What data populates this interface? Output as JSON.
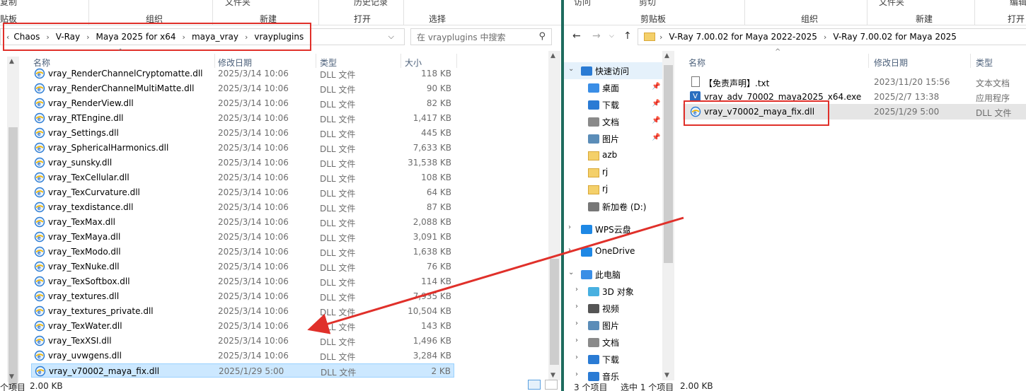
{
  "left": {
    "ribbon": {
      "top_items": [
        "复制",
        "文件夹",
        "历史记录"
      ],
      "groups": [
        "贴板",
        "组织",
        "新建",
        "打开",
        "选择"
      ]
    },
    "breadcrumb": [
      "Chaos",
      "V-Ray",
      "Maya 2025 for x64",
      "maya_vray",
      "vrayplugins"
    ],
    "search_placeholder": "在 vrayplugins 中搜索",
    "columns": {
      "name": "名称",
      "date": "修改日期",
      "type": "类型",
      "size": "大小"
    },
    "rows": [
      {
        "name": "vray_RenderChannelCryptomatte.dll",
        "date": "2025/3/14 10:06",
        "type": "DLL 文件",
        "size": "118 KB"
      },
      {
        "name": "vray_RenderChannelMultiMatte.dll",
        "date": "2025/3/14 10:06",
        "type": "DLL 文件",
        "size": "90 KB"
      },
      {
        "name": "vray_RenderView.dll",
        "date": "2025/3/14 10:06",
        "type": "DLL 文件",
        "size": "82 KB"
      },
      {
        "name": "vray_RTEngine.dll",
        "date": "2025/3/14 10:06",
        "type": "DLL 文件",
        "size": "1,417 KB"
      },
      {
        "name": "vray_Settings.dll",
        "date": "2025/3/14 10:06",
        "type": "DLL 文件",
        "size": "445 KB"
      },
      {
        "name": "vray_SphericalHarmonics.dll",
        "date": "2025/3/14 10:06",
        "type": "DLL 文件",
        "size": "7,633 KB"
      },
      {
        "name": "vray_sunsky.dll",
        "date": "2025/3/14 10:06",
        "type": "DLL 文件",
        "size": "31,538 KB"
      },
      {
        "name": "vray_TexCellular.dll",
        "date": "2025/3/14 10:06",
        "type": "DLL 文件",
        "size": "108 KB"
      },
      {
        "name": "vray_TexCurvature.dll",
        "date": "2025/3/14 10:06",
        "type": "DLL 文件",
        "size": "64 KB"
      },
      {
        "name": "vray_texdistance.dll",
        "date": "2025/3/14 10:06",
        "type": "DLL 文件",
        "size": "87 KB"
      },
      {
        "name": "vray_TexMax.dll",
        "date": "2025/3/14 10:06",
        "type": "DLL 文件",
        "size": "2,088 KB"
      },
      {
        "name": "vray_TexMaya.dll",
        "date": "2025/3/14 10:06",
        "type": "DLL 文件",
        "size": "3,091 KB"
      },
      {
        "name": "vray_TexModo.dll",
        "date": "2025/3/14 10:06",
        "type": "DLL 文件",
        "size": "1,638 KB"
      },
      {
        "name": "vray_TexNuke.dll",
        "date": "2025/3/14 10:06",
        "type": "DLL 文件",
        "size": "76 KB"
      },
      {
        "name": "vray_TexSoftbox.dll",
        "date": "2025/3/14 10:06",
        "type": "DLL 文件",
        "size": "114 KB"
      },
      {
        "name": "vray_textures.dll",
        "date": "2025/3/14 10:06",
        "type": "DLL 文件",
        "size": "7,935 KB"
      },
      {
        "name": "vray_textures_private.dll",
        "date": "2025/3/14 10:06",
        "type": "DLL 文件",
        "size": "10,504 KB"
      },
      {
        "name": "vray_TexWater.dll",
        "date": "2025/3/14 10:06",
        "type": "DLL 文件",
        "size": "143 KB"
      },
      {
        "name": "vray_TexXSI.dll",
        "date": "2025/3/14 10:06",
        "type": "DLL 文件",
        "size": "1,496 KB"
      },
      {
        "name": "vray_uvwgens.dll",
        "date": "2025/3/14 10:06",
        "type": "DLL 文件",
        "size": "3,284 KB"
      },
      {
        "name": "vray_v70002_maya_fix.dll",
        "date": "2025/1/29 5:00",
        "type": "DLL 文件",
        "size": "2 KB"
      }
    ],
    "status": {
      "count": "个项目",
      "size": "2.00 KB"
    }
  },
  "right": {
    "ribbon": {
      "top_items": [
        "访问",
        "剪切",
        "文件夹",
        "编辑"
      ],
      "groups": [
        "剪贴板",
        "组织",
        "新建",
        "打开"
      ]
    },
    "breadcrumb": [
      "V-Ray 7.00.02 for Maya 2022-2025",
      "V-Ray 7.00.02 for Maya 2025"
    ],
    "columns": {
      "name": "名称",
      "date": "修改日期",
      "type": "类型"
    },
    "nav": [
      {
        "label": "快速访问",
        "icon": "star-icon",
        "pinned": false
      },
      {
        "label": "桌面",
        "icon": "desktop-icon",
        "pinned": true
      },
      {
        "label": "下载",
        "icon": "download-icon",
        "pinned": true
      },
      {
        "label": "文档",
        "icon": "document-icon",
        "pinned": true
      },
      {
        "label": "图片",
        "icon": "picture-icon",
        "pinned": true
      },
      {
        "label": "azb",
        "icon": "folder-icon",
        "pinned": false
      },
      {
        "label": "rj",
        "icon": "folder-icon",
        "pinned": false
      },
      {
        "label": "rj",
        "icon": "folder-icon",
        "pinned": false
      },
      {
        "label": "新加卷 (D:)",
        "icon": "drive-icon",
        "pinned": false
      },
      {
        "label": "WPS云盘",
        "icon": "cloud-icon",
        "pinned": false
      },
      {
        "label": "OneDrive",
        "icon": "cloud-icon",
        "pinned": false
      },
      {
        "label": "此电脑",
        "icon": "computer-icon",
        "pinned": false
      },
      {
        "label": "3D 对象",
        "icon": "cube-icon",
        "pinned": false
      },
      {
        "label": "视频",
        "icon": "video-icon",
        "pinned": false
      },
      {
        "label": "图片",
        "icon": "picture-icon",
        "pinned": false
      },
      {
        "label": "文档",
        "icon": "document-icon",
        "pinned": false
      },
      {
        "label": "下载",
        "icon": "download-icon",
        "pinned": false
      },
      {
        "label": "音乐",
        "icon": "music-icon",
        "pinned": false
      }
    ],
    "files": [
      {
        "name": "【免责声明】.txt",
        "date": "2023/11/20 15:56",
        "type": "文本文档"
      },
      {
        "name": "vray_adv_70002_maya2025_x64.exe",
        "date": "2025/2/7 13:38",
        "type": "应用程序"
      },
      {
        "name": "vray_v70002_maya_fix.dll",
        "date": "2025/1/29 5:00",
        "type": "DLL 文件"
      }
    ],
    "status": {
      "count": "3 个项目",
      "selected": "选中 1 个项目",
      "size": "2.00 KB"
    }
  },
  "colors": {
    "highlight": "#e0302a",
    "selection": "#cce8ff",
    "divider": "#1e6b5e"
  }
}
